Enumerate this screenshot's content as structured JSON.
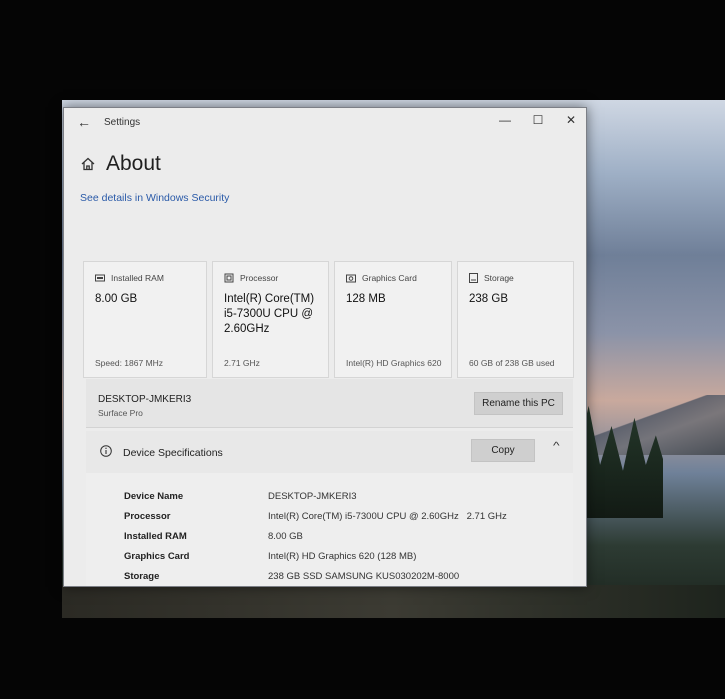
{
  "window": {
    "title": "Settings",
    "controls": {
      "minimize": "—",
      "maximize": "☐",
      "close": "✕"
    }
  },
  "page": {
    "title": "About",
    "security_link": "See details in Windows Security"
  },
  "cards": [
    {
      "heading": "Installed RAM",
      "value": "8.00 GB",
      "footer": "Speed: 1867 MHz",
      "icon": "ram-icon"
    },
    {
      "heading": "Processor",
      "value": "Intel(R) Core(TM) i5-7300U CPU @ 2.60GHz",
      "footer": "2.71 GHz",
      "icon": "processor-icon"
    },
    {
      "heading": "Graphics Card",
      "value": "128 MB",
      "footer": "Intel(R) HD Graphics 620",
      "icon": "graphics-card-icon"
    },
    {
      "heading": "Storage",
      "value": "238 GB",
      "footer": "60 GB of 238 GB used",
      "icon": "storage-icon"
    }
  ],
  "pc": {
    "name": "DESKTOP-JMKERI3",
    "model": "Surface Pro",
    "rename_label": "Rename this PC"
  },
  "specs": {
    "heading": "Device Specifications",
    "copy_label": "Copy",
    "rows": [
      {
        "label": "Device Name",
        "value": "DESKTOP-JMKERI3"
      },
      {
        "label": "Processor",
        "value": "Intel(R) Core(TM) i5-7300U CPU @ 2.60GHz   2.71 GHz"
      },
      {
        "label": "Installed RAM",
        "value": "8.00 GB"
      },
      {
        "label": "Graphics Card",
        "value": "Intel(R) HD Graphics 620 (128 MB)"
      },
      {
        "label": "Storage",
        "value": "238 GB SSD SAMSUNG KUS030202M-8000"
      }
    ]
  },
  "colors": {
    "link": "#2a5aa8",
    "window_bg": "#ececec",
    "button_bg": "#cfcfcf"
  }
}
